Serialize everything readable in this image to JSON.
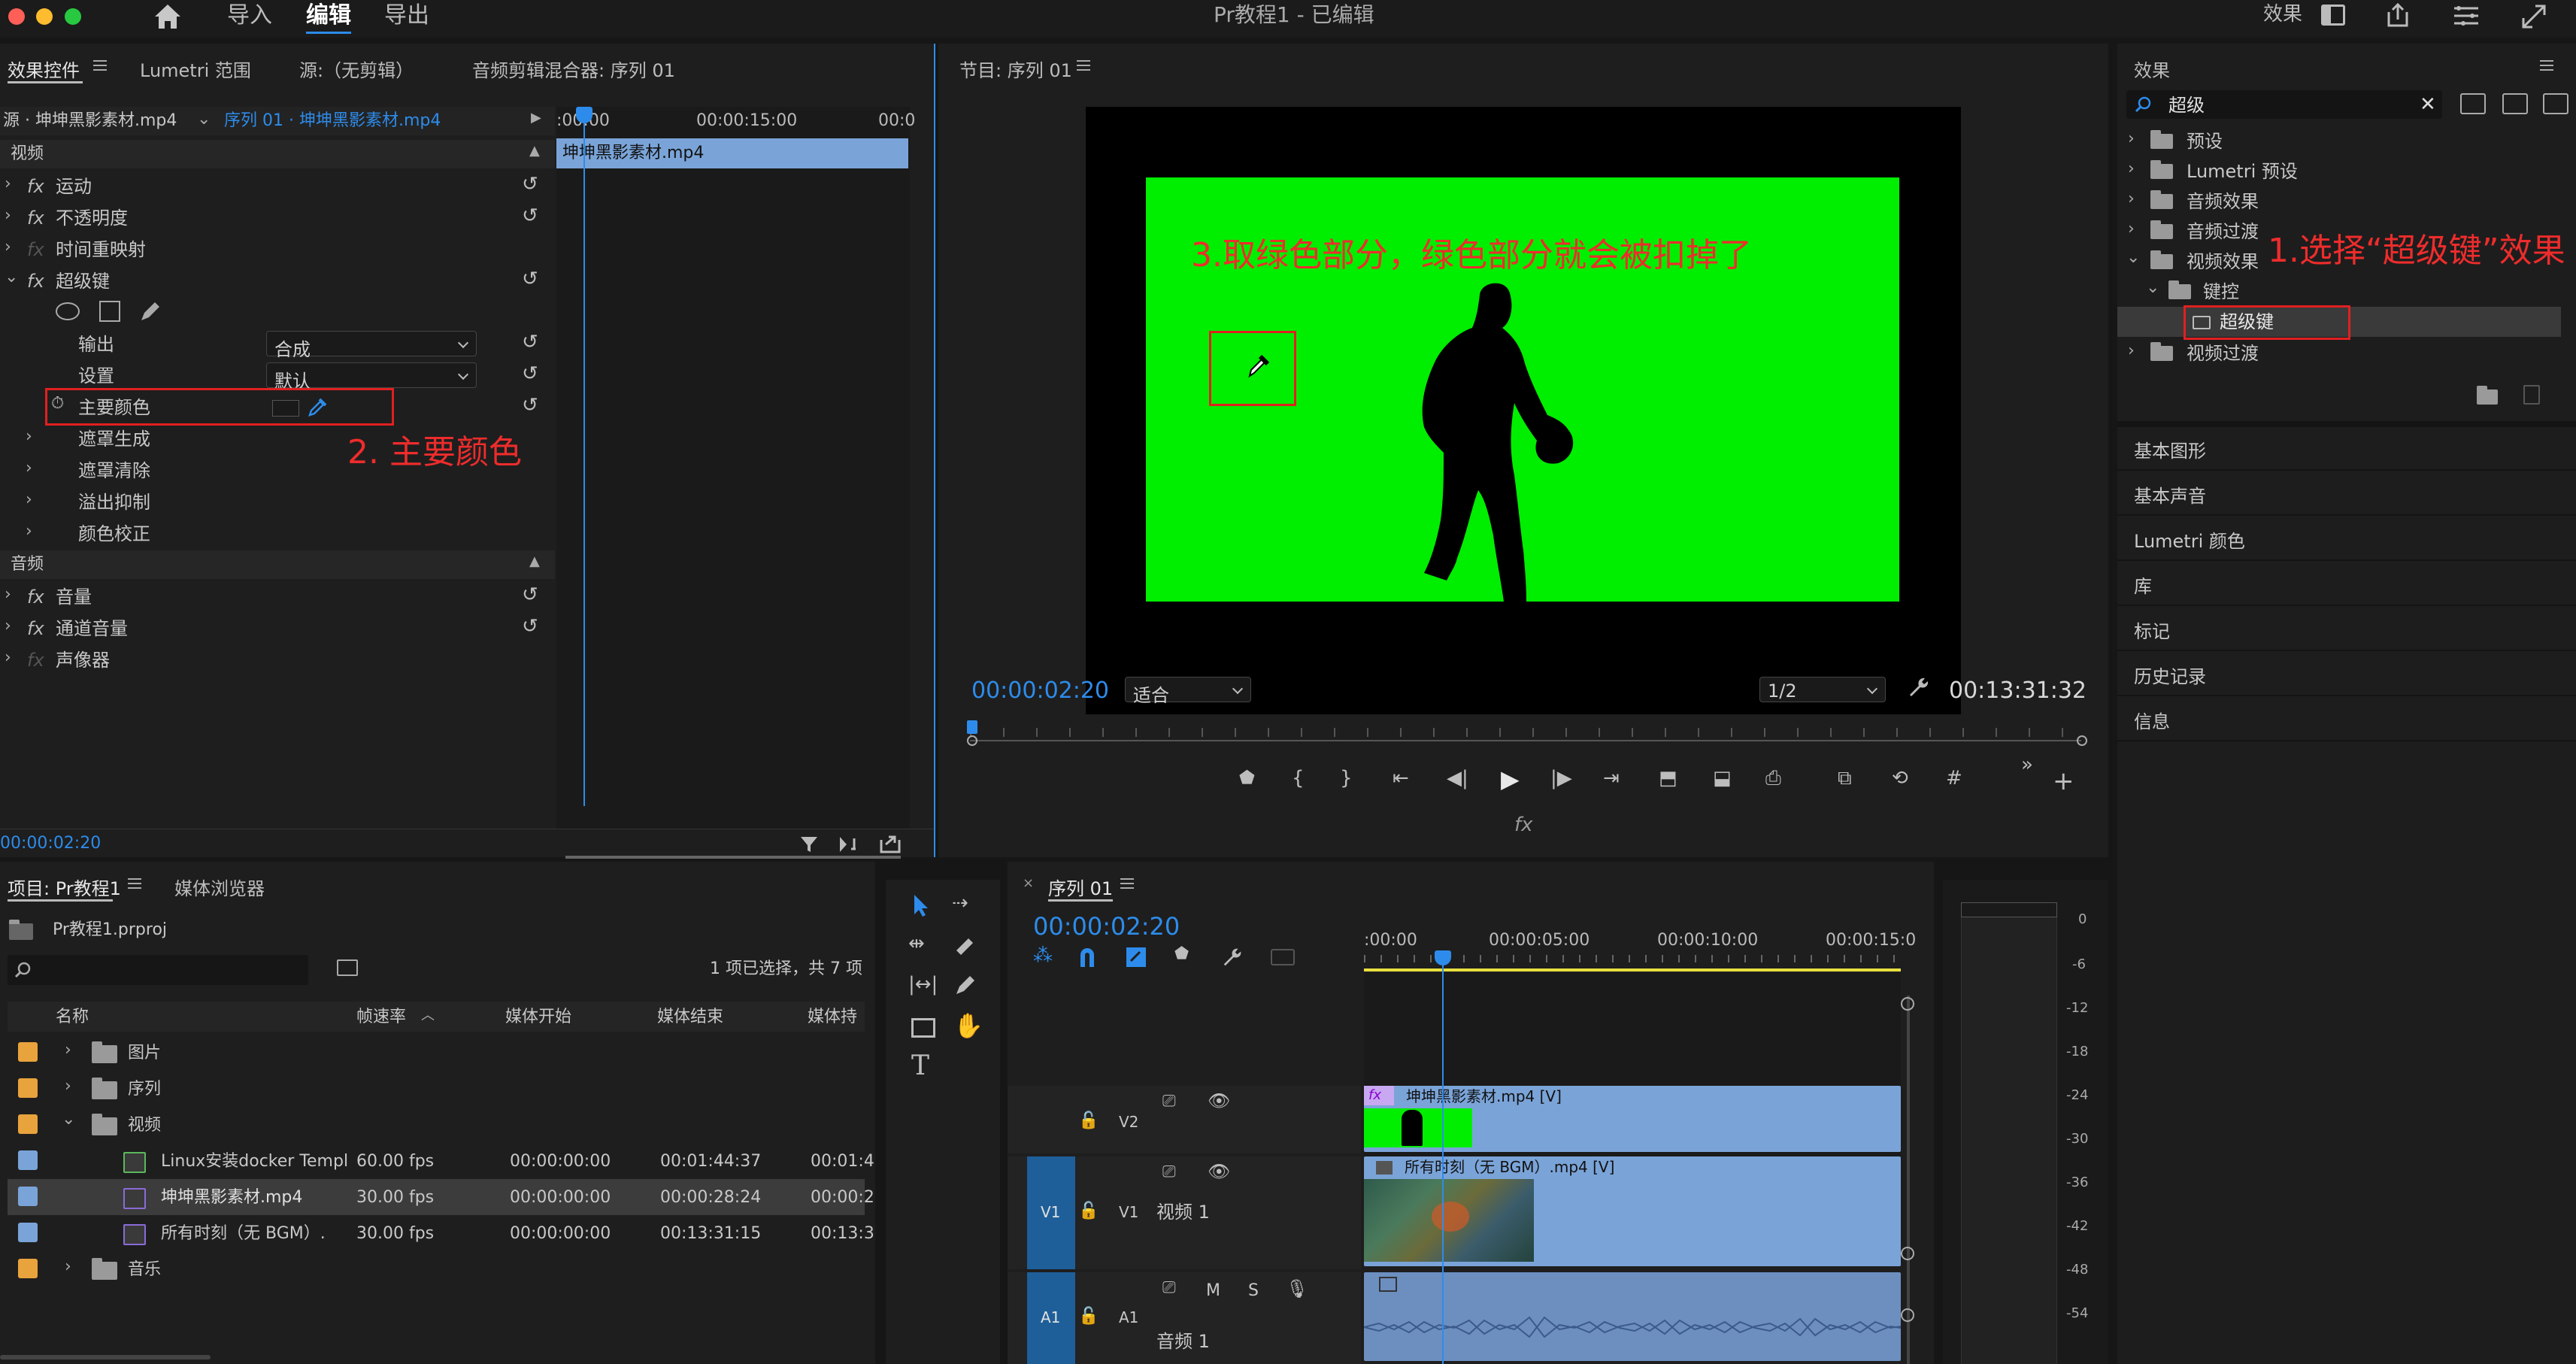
{
  "topbar": {
    "home_label": "",
    "tabs": [
      "导入",
      "编辑",
      "导出"
    ],
    "active_tab": "编辑",
    "title": "Pr教程1 - 已编辑",
    "right_label": "效果"
  },
  "effect_controls": {
    "tabs": [
      "效果控件",
      "Lumetri 范围",
      "源:（无剪辑）",
      "音频剪辑混合器: 序列 01"
    ],
    "source_label": "源 · 坤坤黑影素材.mp4",
    "sequence_label": "序列 01 · 坤坤黑影素材.mp4",
    "time_marks": [
      ":00:00",
      "00:00:15:00",
      "00:0"
    ],
    "clip_label": "坤坤黑影素材.mp4",
    "video_section": "视频",
    "video_effects": [
      "运动",
      "不透明度",
      "时间重映射",
      "超级键"
    ],
    "props": {
      "output_label": "输出",
      "output_value": "合成",
      "setting_label": "设置",
      "setting_value": "默认",
      "key_color_label": "主要颜色",
      "sub_items": [
        "遮罩生成",
        "遮罩清除",
        "溢出抑制",
        "颜色校正"
      ]
    },
    "audio_section": "音频",
    "audio_effects": [
      "音量",
      "通道音量",
      "声像器"
    ],
    "current_time": "00:00:02:20",
    "annotation": "2. 主要颜色"
  },
  "program_monitor": {
    "title": "节目: 序列 01",
    "annotation": "3.取绿色部分，绿色部分就会被扣掉了",
    "timecode": "00:00:02:20",
    "fit_value": "适合",
    "resolution_value": "1/2",
    "duration": "00:13:31:32",
    "fx_label": "fx"
  },
  "effects_panel": {
    "title": "效果",
    "search_value": "超级",
    "tree": [
      "预设",
      "Lumetri 预设",
      "音频效果",
      "音频过渡",
      "视频效果",
      "键控",
      "超级键",
      "视频过渡"
    ],
    "annotation": "1.选择“超级键”效果",
    "sections": [
      "基本图形",
      "基本声音",
      "Lumetri 颜色",
      "库",
      "标记",
      "历史记录",
      "信息"
    ]
  },
  "project_panel": {
    "tabs": [
      "项目: Pr教程1",
      "媒体浏览器"
    ],
    "project_file": "Pr教程1.prproj",
    "selection_info": "1 项已选择，共 7 项",
    "columns": [
      "名称",
      "帧速率",
      "媒体开始",
      "媒体结束",
      "媒体持"
    ],
    "rows": [
      {
        "name": "图片",
        "fps": "",
        "start": "",
        "end": "",
        "dur": ""
      },
      {
        "name": "序列",
        "fps": "",
        "start": "",
        "end": "",
        "dur": ""
      },
      {
        "name": "视频",
        "fps": "",
        "start": "",
        "end": "",
        "dur": ""
      },
      {
        "name": "Linux安装docker Templ",
        "fps": "60.00 fps",
        "start": "00:00:00:00",
        "end": "00:01:44:37",
        "dur": "00:01:4"
      },
      {
        "name": "坤坤黑影素材.mp4",
        "fps": "30.00 fps",
        "start": "00:00:00:00",
        "end": "00:00:28:24",
        "dur": "00:00:2"
      },
      {
        "name": "所有时刻（无 BGM）.",
        "fps": "30.00 fps",
        "start": "00:00:00:00",
        "end": "00:13:31:15",
        "dur": "00:13:3"
      },
      {
        "name": "音乐",
        "fps": "",
        "start": "",
        "end": "",
        "dur": ""
      }
    ]
  },
  "timeline": {
    "title": "序列 01",
    "timecode": "00:00:02:20",
    "ruler": [
      ":00:00",
      "00:00:05:00",
      "00:00:10:00",
      "00:00:15:0"
    ],
    "tracks": {
      "v2": "V2",
      "v1": "V1",
      "v1_name": "视频 1",
      "a1": "A1",
      "a1_name": "音频 1",
      "m": "M",
      "s": "S"
    },
    "clip_v2": "坤坤黑影素材.mp4 [V]",
    "clip_v1": "所有时刻（无 BGM）.mp4 [V]",
    "fx_badge": "fx"
  },
  "meter": {
    "scale": [
      "0",
      "-6",
      "-12",
      "-18",
      "-24",
      "-30",
      "-36",
      "-42",
      "-48",
      "-54"
    ]
  },
  "colors": {
    "accent_blue": "#2d8ceb",
    "green_screen": "#00ee00",
    "annotation_red": "#ee2c2c",
    "clip_blue": "#7aa4d8"
  }
}
